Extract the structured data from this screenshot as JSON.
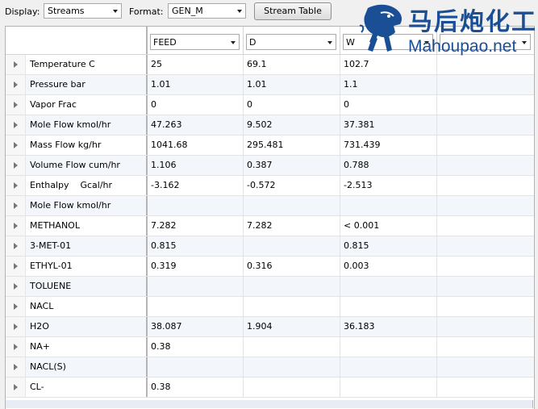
{
  "toolbar": {
    "display_label": "Display:",
    "display_value": "Streams",
    "format_label": "Format:",
    "format_value": "GEN_M",
    "stream_table_button": "Stream Table"
  },
  "logo": {
    "cn_text": "马后炮化工",
    "en_text": "Mahoupao.net"
  },
  "columns": [
    "FEED",
    "D",
    "W",
    ""
  ],
  "rows": [
    {
      "name": "Temperature C",
      "values": [
        "25",
        "69.1",
        "102.7",
        ""
      ]
    },
    {
      "name": "Pressure bar",
      "values": [
        "1.01",
        "1.01",
        "1.1",
        ""
      ]
    },
    {
      "name": "Vapor Frac",
      "values": [
        "0",
        "0",
        "0",
        ""
      ]
    },
    {
      "name": "Mole Flow kmol/hr",
      "values": [
        "47.263",
        "9.502",
        "37.381",
        ""
      ]
    },
    {
      "name": "Mass Flow kg/hr",
      "values": [
        "1041.68",
        "295.481",
        "731.439",
        ""
      ]
    },
    {
      "name": "Volume Flow cum/hr",
      "values": [
        "1.106",
        "0.387",
        "0.788",
        ""
      ]
    },
    {
      "name": "Enthalpy    Gcal/hr",
      "values": [
        "-3.162",
        "-0.572",
        "-2.513",
        ""
      ]
    },
    {
      "name": "Mole Flow kmol/hr",
      "values": [
        "",
        "",
        "",
        ""
      ]
    },
    {
      "name": "METHANOL",
      "values": [
        "7.282",
        "7.282",
        "< 0.001",
        ""
      ]
    },
    {
      "name": "3-MET-01",
      "values": [
        "0.815",
        "",
        "0.815",
        ""
      ]
    },
    {
      "name": "ETHYL-01",
      "values": [
        "0.319",
        "0.316",
        "0.003",
        ""
      ]
    },
    {
      "name": "TOLUENE",
      "values": [
        "",
        "",
        "",
        ""
      ]
    },
    {
      "name": "NACL",
      "values": [
        "",
        "",
        "",
        ""
      ]
    },
    {
      "name": "H2O",
      "values": [
        "38.087",
        "1.904",
        "36.183",
        ""
      ]
    },
    {
      "name": "NA+",
      "values": [
        "0.38",
        "",
        "",
        ""
      ]
    },
    {
      "name": "NACL(S)",
      "values": [
        "",
        "",
        "",
        ""
      ]
    },
    {
      "name": "CL-",
      "values": [
        "0.38",
        "",
        "",
        ""
      ]
    }
  ],
  "colors": {
    "logo_blue": "#1a4f96",
    "alt_row": "#f3f7fc"
  }
}
